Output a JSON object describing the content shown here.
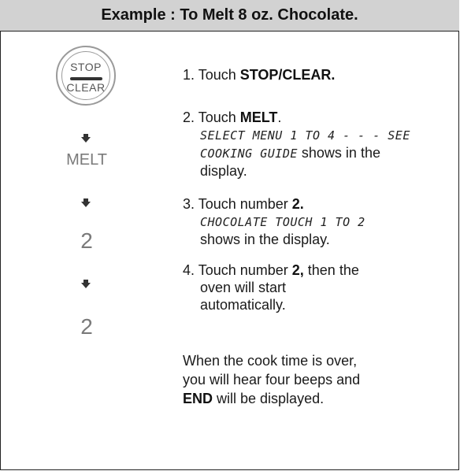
{
  "header": {
    "title": "Example : To Melt 8 oz. Chocolate."
  },
  "keys": {
    "stop_top": "STOP",
    "stop_bottom": "CLEAR",
    "melt": "MELT",
    "num_first": "2",
    "num_second": "2"
  },
  "steps": [
    {
      "text": "1. Touch ",
      "bold": "STOP/CLEAR."
    },
    {
      "text": "2. Touch ",
      "bold": "MELT",
      "after": ".",
      "lcd": "SELECT MENU 1 TO 4 - - - SEE",
      "lcd2": "COOKING GUIDE",
      "tail": " shows in the",
      "tail2": "display."
    },
    {
      "text": "3. Touch number ",
      "bold": "2.",
      "lcd": "CHOCOLATE TOUCH 1 TO 2",
      "tail": "shows in the display."
    },
    {
      "text": "4. Touch number ",
      "bold": "2,",
      "after": " then the",
      "line2": "oven will start",
      "line3": "automatically."
    }
  ],
  "note": {
    "line1": "When the cook time is over,",
    "line2": "you will hear four beeps and",
    "bold": "END",
    "line3_after": " will be displayed."
  }
}
